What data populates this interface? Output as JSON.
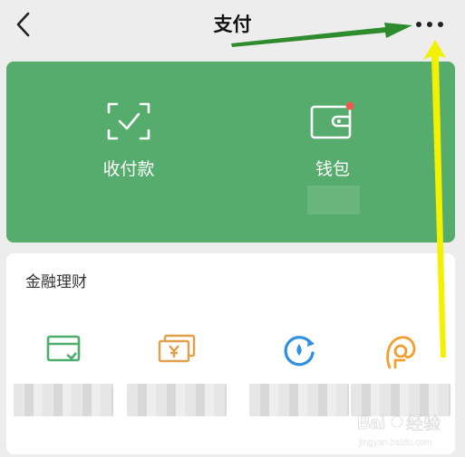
{
  "header": {
    "title": "支付",
    "back_icon": "chevron-left-icon",
    "more_icon": "more-horizontal-icon"
  },
  "wallet_card": {
    "background_color": "#56ac6d",
    "actions": [
      {
        "label": "收付款",
        "icon": "scan-check-icon"
      },
      {
        "label": "钱包",
        "icon": "wallet-icon",
        "badge": "red-dot"
      }
    ]
  },
  "finance": {
    "title": "金融理财",
    "items": [
      {
        "icon": "card-repay-icon",
        "color": "#4cae6a"
      },
      {
        "icon": "yuan-bills-icon",
        "color": "#e0a04a"
      },
      {
        "icon": "refresh-coin-icon",
        "color": "#2f8fe0"
      },
      {
        "icon": "face-coin-icon",
        "color": "#f0a030"
      }
    ]
  },
  "annotations": {
    "arrow_green_color": "#2e8b2e",
    "arrow_yellow_color": "#f2f200"
  },
  "watermark": {
    "text": "Bai 经验",
    "subtext": "jingyan.baidu.com"
  }
}
